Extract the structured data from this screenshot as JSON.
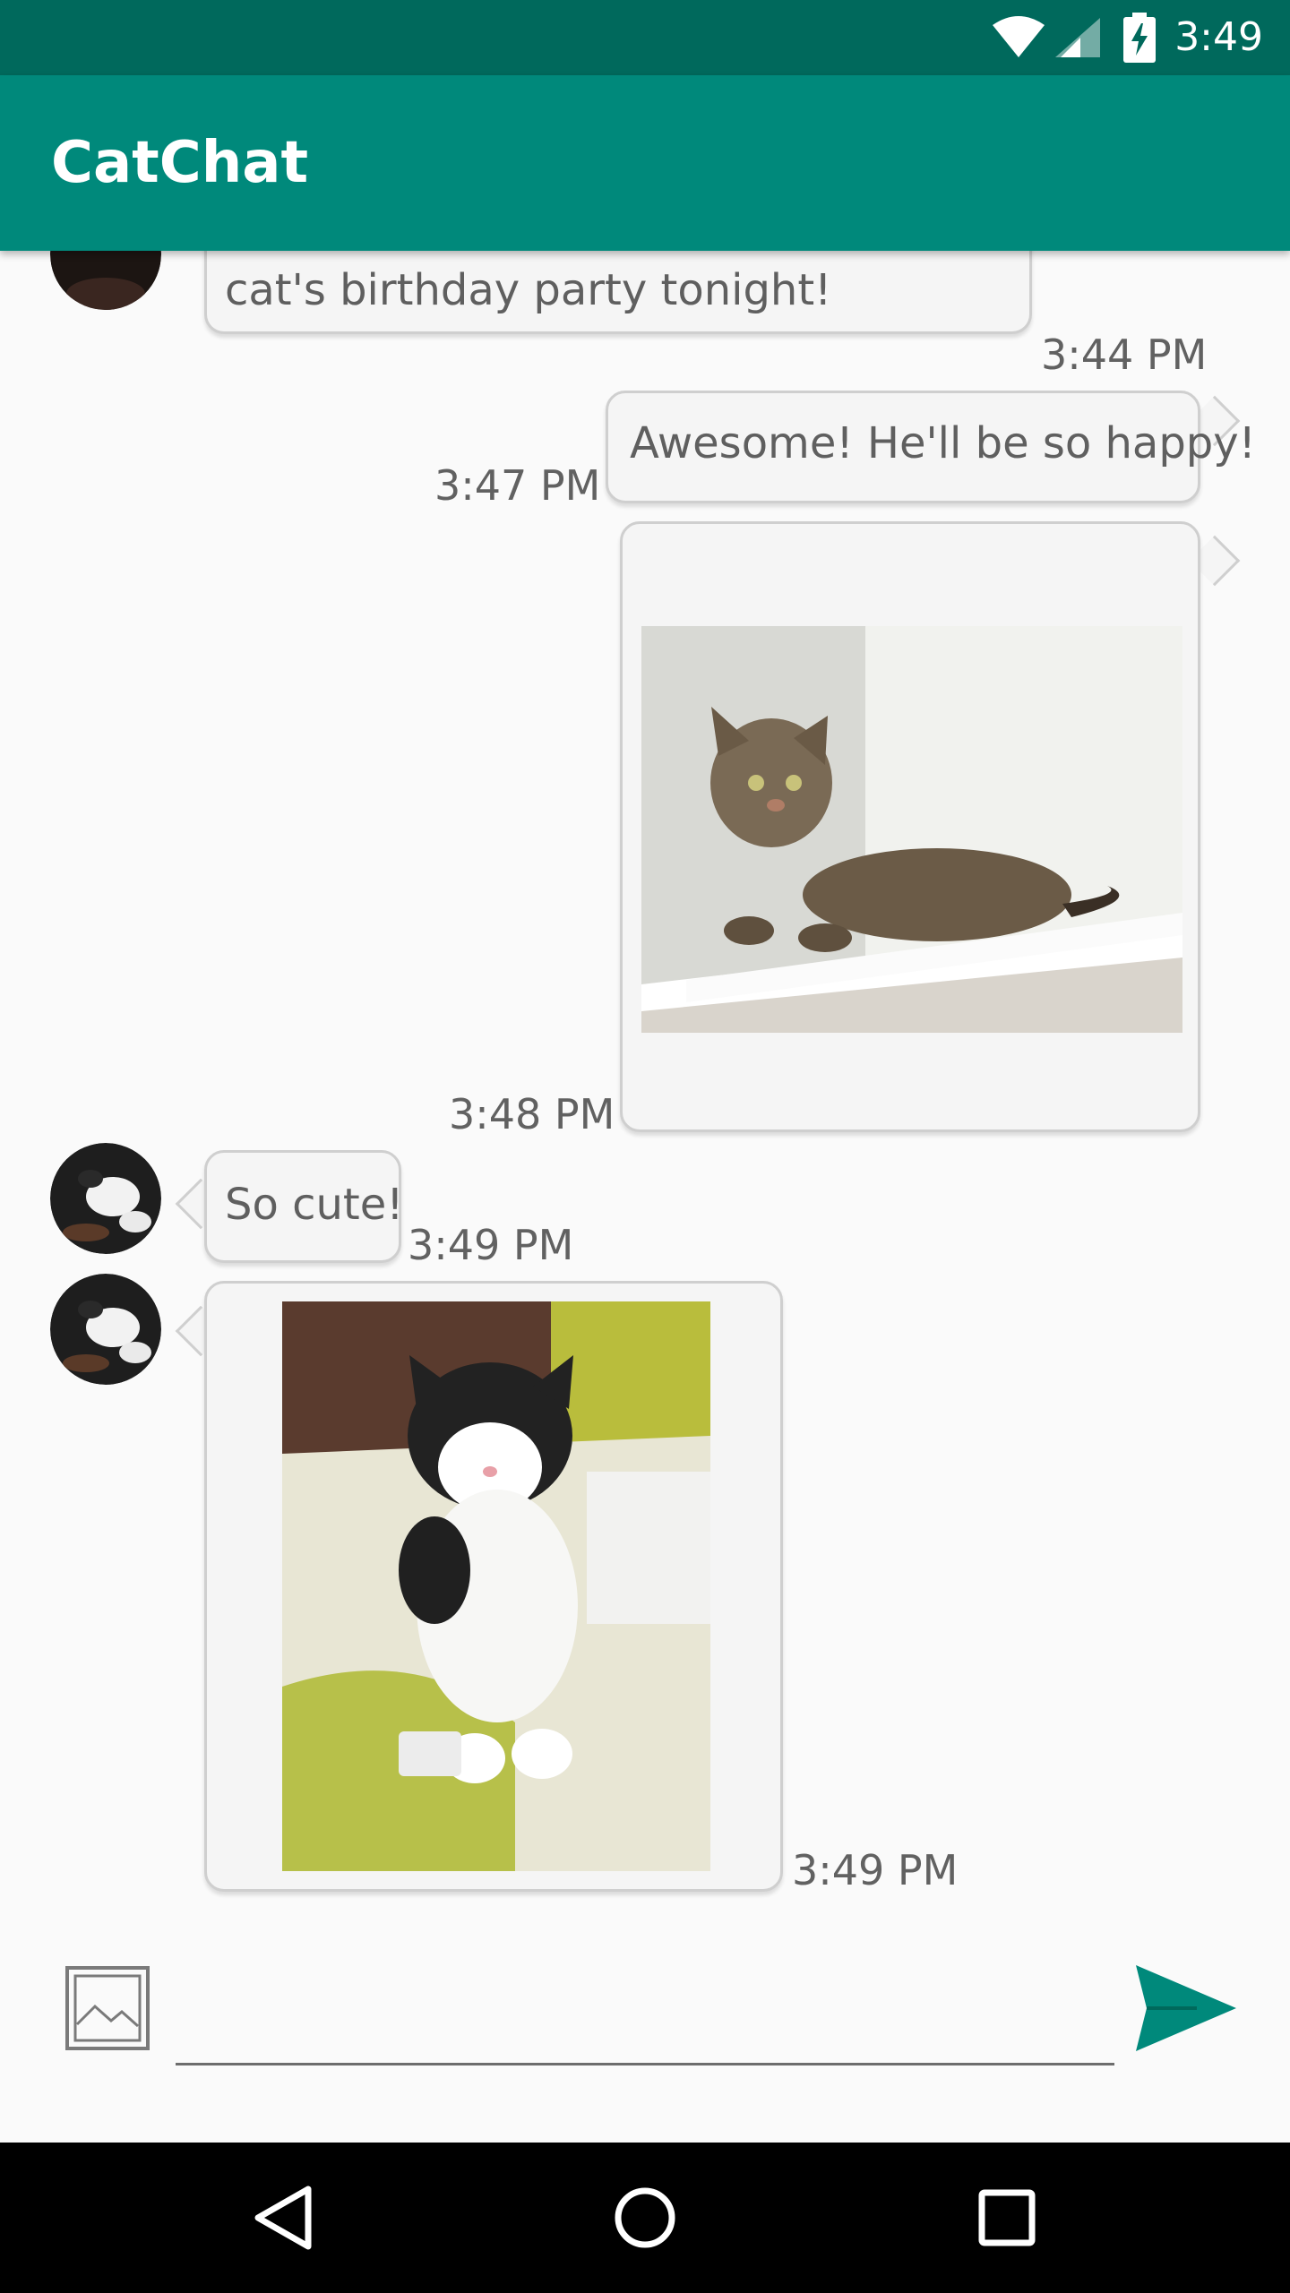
{
  "status_bar": {
    "time": "3:49",
    "icons": [
      "wifi-icon",
      "signal-icon",
      "battery-charging-icon"
    ]
  },
  "app_bar": {
    "title": "CatChat"
  },
  "messages": [
    {
      "side": "left",
      "type": "text",
      "text": "cat's birthday party tonight!",
      "time": "3:44 PM"
    },
    {
      "side": "right",
      "type": "text",
      "text": "Awesome! He'll be so happy!",
      "time": "3:47 PM"
    },
    {
      "side": "right",
      "type": "image",
      "image": "tabby-cat-photo",
      "time": "3:48 PM"
    },
    {
      "side": "left",
      "type": "text",
      "text": "So cute!",
      "time": "3:49 PM"
    },
    {
      "side": "left",
      "type": "image",
      "image": "tuxedo-cat-photo",
      "time": "3:49 PM"
    }
  ],
  "composer": {
    "image_button_icon": "image-icon",
    "input_value": "",
    "input_placeholder": "",
    "send_button_icon": "send-icon"
  },
  "nav_bar": {
    "icons": [
      "back-icon",
      "home-icon",
      "recents-icon"
    ]
  },
  "colors": {
    "status_bar": "#00695c",
    "app_bar": "#00897b",
    "accent": "#00897b"
  }
}
